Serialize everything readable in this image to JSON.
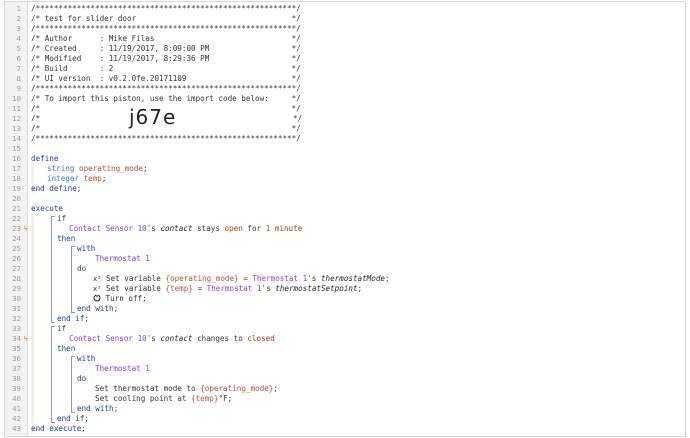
{
  "header_comment": [
    "/*********************************************************/",
    "/* test for slider door                                  */",
    "/*********************************************************/",
    "/* Author      : Mike Filas                              */",
    "/* Created     : 11/19/2017, 8:09:00 PM                  */",
    "/* Modified    : 11/19/2017, 8:29:36 PM                  */",
    "/* Build       : 2                                       */",
    "/* UI version  : v0.2.0fe.20171109                       */",
    "/*********************************************************/",
    "/* To import this piston, use the import code below:     */",
    "/*                                                       */",
    "/*",
    "/*                                                       */",
    "/*********************************************************/"
  ],
  "import_code": "j67e",
  "import_code_line_tail": "*/",
  "define": {
    "keyword": "define",
    "vars": [
      {
        "type": "string",
        "name": "operating_mode",
        "end": ";"
      },
      {
        "type": "integer",
        "name": "temp",
        "end": ";"
      }
    ],
    "end": "end define;"
  },
  "execute": {
    "keyword": "execute",
    "end": "end execute;",
    "if1": {
      "if": "if",
      "device": "Contact Sensor 10",
      "poss": "'s",
      "attr": "contact",
      "op1": "stays",
      "value": "open",
      "op2": "for",
      "num": "1",
      "unit": "minute",
      "then": "then",
      "with": "with",
      "with_device": "Thermostat 1",
      "do": "do",
      "a1_icon": "x²",
      "a1_text": "Set variable",
      "a1_var": "{operating_mode}",
      "a1_eq": "=",
      "a1_dev": "Thermostat 1",
      "a1_attr": "thermostatMode",
      "a2_icon": "x²",
      "a2_text": "Set variable",
      "a2_var": "{temp}",
      "a2_eq": "=",
      "a2_dev": "Thermostat 1",
      "a2_attr": "thermostatSetpoint",
      "a3_icon": "power-icon",
      "a3_text": "Turn off;",
      "end_with": "end with;",
      "end_if": "end if;"
    },
    "if2": {
      "if": "if",
      "device": "Contact Sensor 10",
      "poss": "'s",
      "attr": "contact",
      "op": "changes to",
      "value": "closed",
      "then": "then",
      "with": "with",
      "with_device": "Thermostat 1",
      "do": "do",
      "a1_text": "Set thermostat mode to",
      "a1_var": "{operating_mode}",
      "a2_text": "Set cooling point at",
      "a2_var": "{temp}",
      "a2_unit": "°F;",
      "end_with": "end with;",
      "end_if": "end if;"
    }
  },
  "line_count": 43,
  "trigger_marker": "ϟ",
  "trigger_lines": [
    23,
    34
  ]
}
